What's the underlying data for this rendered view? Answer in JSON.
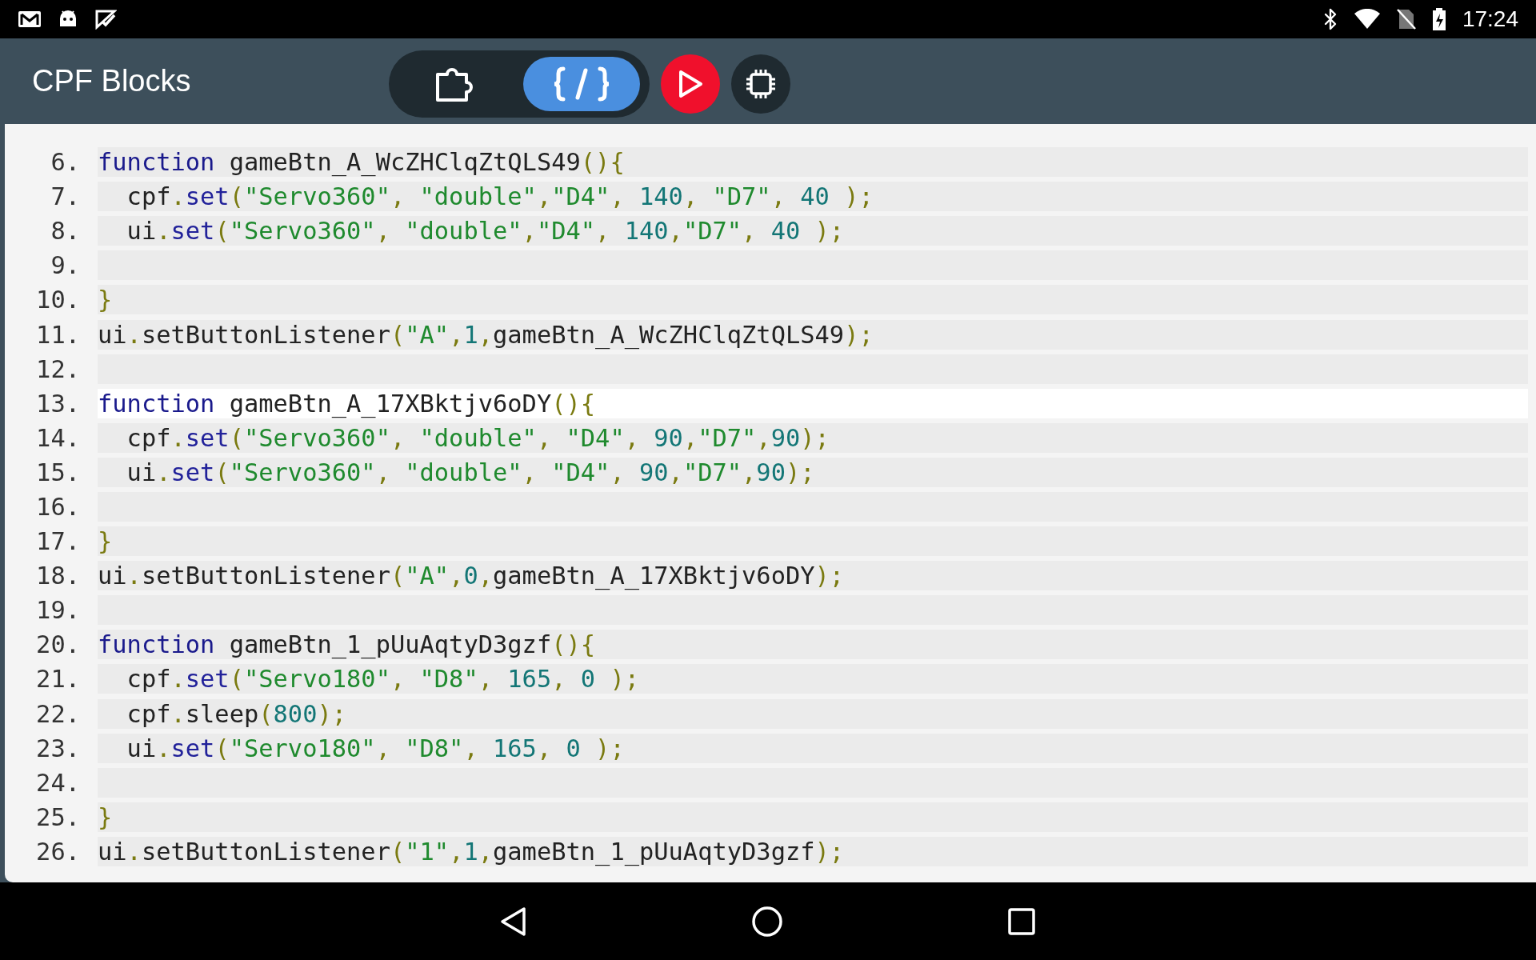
{
  "status_bar": {
    "time": "17:24"
  },
  "app_bar": {
    "title": "CPF Blocks",
    "view_tabs": [
      {
        "kind": "blocks",
        "selected": false
      },
      {
        "kind": "code",
        "selected": true
      }
    ],
    "run_button": {
      "kind": "run"
    },
    "device_button": {
      "kind": "device"
    }
  },
  "code": {
    "lines": [
      {
        "number": "6.",
        "active": false,
        "tokens": [
          {
            "kind": "kw",
            "text": "function"
          },
          {
            "kind": "plain",
            "text": " gameBtn_A_WcZHClqZtQLS49"
          },
          {
            "kind": "punct",
            "text": "(){"
          }
        ]
      },
      {
        "number": "7.",
        "active": false,
        "tokens": [
          {
            "kind": "plain",
            "text": "  cpf"
          },
          {
            "kind": "punct",
            "text": "."
          },
          {
            "kind": "prop",
            "text": "set"
          },
          {
            "kind": "punct",
            "text": "("
          },
          {
            "kind": "str",
            "text": "\"Servo360\""
          },
          {
            "kind": "punct",
            "text": ", "
          },
          {
            "kind": "str",
            "text": "\"double\""
          },
          {
            "kind": "punct",
            "text": ","
          },
          {
            "kind": "str",
            "text": "\"D4\""
          },
          {
            "kind": "punct",
            "text": ", "
          },
          {
            "kind": "num",
            "text": "140"
          },
          {
            "kind": "punct",
            "text": ", "
          },
          {
            "kind": "str",
            "text": "\"D7\""
          },
          {
            "kind": "punct",
            "text": ", "
          },
          {
            "kind": "num",
            "text": "40"
          },
          {
            "kind": "punct",
            "text": " );"
          }
        ]
      },
      {
        "number": "8.",
        "active": false,
        "tokens": [
          {
            "kind": "plain",
            "text": "  ui"
          },
          {
            "kind": "punct",
            "text": "."
          },
          {
            "kind": "prop",
            "text": "set"
          },
          {
            "kind": "punct",
            "text": "("
          },
          {
            "kind": "str",
            "text": "\"Servo360\""
          },
          {
            "kind": "punct",
            "text": ", "
          },
          {
            "kind": "str",
            "text": "\"double\""
          },
          {
            "kind": "punct",
            "text": ","
          },
          {
            "kind": "str",
            "text": "\"D4\""
          },
          {
            "kind": "punct",
            "text": ", "
          },
          {
            "kind": "num",
            "text": "140"
          },
          {
            "kind": "punct",
            "text": ","
          },
          {
            "kind": "str",
            "text": "\"D7\""
          },
          {
            "kind": "punct",
            "text": ", "
          },
          {
            "kind": "num",
            "text": "40"
          },
          {
            "kind": "punct",
            "text": " );"
          }
        ]
      },
      {
        "number": "9.",
        "active": false
      },
      {
        "number": "10.",
        "active": false,
        "tokens": [
          {
            "kind": "punct",
            "text": "}"
          }
        ]
      },
      {
        "number": "11.",
        "active": false,
        "tokens": [
          {
            "kind": "plain",
            "text": "ui"
          },
          {
            "kind": "punct",
            "text": "."
          },
          {
            "kind": "plain",
            "text": "setButtonListener"
          },
          {
            "kind": "punct",
            "text": "("
          },
          {
            "kind": "str",
            "text": "\"A\""
          },
          {
            "kind": "punct",
            "text": ","
          },
          {
            "kind": "num",
            "text": "1"
          },
          {
            "kind": "punct",
            "text": ","
          },
          {
            "kind": "plain",
            "text": "gameBtn_A_WcZHClqZtQLS49"
          },
          {
            "kind": "punct",
            "text": ");"
          }
        ]
      },
      {
        "number": "12.",
        "active": false
      },
      {
        "number": "13.",
        "active": true,
        "tokens": [
          {
            "kind": "kw",
            "text": "function"
          },
          {
            "kind": "plain",
            "text": " gameBtn_A_17XBktjv6oDY"
          },
          {
            "kind": "punct",
            "text": "(){"
          }
        ]
      },
      {
        "number": "14.",
        "active": false,
        "tokens": [
          {
            "kind": "plain",
            "text": "  cpf"
          },
          {
            "kind": "punct",
            "text": "."
          },
          {
            "kind": "prop",
            "text": "set"
          },
          {
            "kind": "punct",
            "text": "("
          },
          {
            "kind": "str",
            "text": "\"Servo360\""
          },
          {
            "kind": "punct",
            "text": ", "
          },
          {
            "kind": "str",
            "text": "\"double\""
          },
          {
            "kind": "punct",
            "text": ", "
          },
          {
            "kind": "str",
            "text": "\"D4\""
          },
          {
            "kind": "punct",
            "text": ", "
          },
          {
            "kind": "num",
            "text": "90"
          },
          {
            "kind": "punct",
            "text": ","
          },
          {
            "kind": "str",
            "text": "\"D7\""
          },
          {
            "kind": "punct",
            "text": ","
          },
          {
            "kind": "num",
            "text": "90"
          },
          {
            "kind": "punct",
            "text": ");"
          }
        ]
      },
      {
        "number": "15.",
        "active": false,
        "tokens": [
          {
            "kind": "plain",
            "text": "  ui"
          },
          {
            "kind": "punct",
            "text": "."
          },
          {
            "kind": "prop",
            "text": "set"
          },
          {
            "kind": "punct",
            "text": "("
          },
          {
            "kind": "str",
            "text": "\"Servo360\""
          },
          {
            "kind": "punct",
            "text": ", "
          },
          {
            "kind": "str",
            "text": "\"double\""
          },
          {
            "kind": "punct",
            "text": ", "
          },
          {
            "kind": "str",
            "text": "\"D4\""
          },
          {
            "kind": "punct",
            "text": ", "
          },
          {
            "kind": "num",
            "text": "90"
          },
          {
            "kind": "punct",
            "text": ","
          },
          {
            "kind": "str",
            "text": "\"D7\""
          },
          {
            "kind": "punct",
            "text": ","
          },
          {
            "kind": "num",
            "text": "90"
          },
          {
            "kind": "punct",
            "text": ");"
          }
        ]
      },
      {
        "number": "16.",
        "active": false
      },
      {
        "number": "17.",
        "active": false,
        "tokens": [
          {
            "kind": "punct",
            "text": "}"
          }
        ]
      },
      {
        "number": "18.",
        "active": false,
        "tokens": [
          {
            "kind": "plain",
            "text": "ui"
          },
          {
            "kind": "punct",
            "text": "."
          },
          {
            "kind": "plain",
            "text": "setButtonListener"
          },
          {
            "kind": "punct",
            "text": "("
          },
          {
            "kind": "str",
            "text": "\"A\""
          },
          {
            "kind": "punct",
            "text": ","
          },
          {
            "kind": "num",
            "text": "0"
          },
          {
            "kind": "punct",
            "text": ","
          },
          {
            "kind": "plain",
            "text": "gameBtn_A_17XBktjv6oDY"
          },
          {
            "kind": "punct",
            "text": ");"
          }
        ]
      },
      {
        "number": "19.",
        "active": false
      },
      {
        "number": "20.",
        "active": false,
        "tokens": [
          {
            "kind": "kw",
            "text": "function"
          },
          {
            "kind": "plain",
            "text": " gameBtn_1_pUuAqtyD3gzf"
          },
          {
            "kind": "punct",
            "text": "(){"
          }
        ]
      },
      {
        "number": "21.",
        "active": false,
        "tokens": [
          {
            "kind": "plain",
            "text": "  cpf"
          },
          {
            "kind": "punct",
            "text": "."
          },
          {
            "kind": "prop",
            "text": "set"
          },
          {
            "kind": "punct",
            "text": "("
          },
          {
            "kind": "str",
            "text": "\"Servo180\""
          },
          {
            "kind": "punct",
            "text": ", "
          },
          {
            "kind": "str",
            "text": "\"D8\""
          },
          {
            "kind": "punct",
            "text": ", "
          },
          {
            "kind": "num",
            "text": "165"
          },
          {
            "kind": "punct",
            "text": ", "
          },
          {
            "kind": "num",
            "text": "0"
          },
          {
            "kind": "punct",
            "text": " );"
          }
        ]
      },
      {
        "number": "22.",
        "active": false,
        "tokens": [
          {
            "kind": "plain",
            "text": "  cpf"
          },
          {
            "kind": "punct",
            "text": "."
          },
          {
            "kind": "plain",
            "text": "sleep"
          },
          {
            "kind": "punct",
            "text": "("
          },
          {
            "kind": "num",
            "text": "800"
          },
          {
            "kind": "punct",
            "text": ");"
          }
        ]
      },
      {
        "number": "23.",
        "active": false,
        "tokens": [
          {
            "kind": "plain",
            "text": "  ui"
          },
          {
            "kind": "punct",
            "text": "."
          },
          {
            "kind": "prop",
            "text": "set"
          },
          {
            "kind": "punct",
            "text": "("
          },
          {
            "kind": "str",
            "text": "\"Servo180\""
          },
          {
            "kind": "punct",
            "text": ", "
          },
          {
            "kind": "str",
            "text": "\"D8\""
          },
          {
            "kind": "punct",
            "text": ", "
          },
          {
            "kind": "num",
            "text": "165"
          },
          {
            "kind": "punct",
            "text": ", "
          },
          {
            "kind": "num",
            "text": "0"
          },
          {
            "kind": "punct",
            "text": " );"
          }
        ]
      },
      {
        "number": "24.",
        "active": false
      },
      {
        "number": "25.",
        "active": false,
        "tokens": [
          {
            "kind": "punct",
            "text": "}"
          }
        ]
      },
      {
        "number": "26.",
        "active": false,
        "tokens": [
          {
            "kind": "plain",
            "text": "ui"
          },
          {
            "kind": "punct",
            "text": "."
          },
          {
            "kind": "plain",
            "text": "setButtonListener"
          },
          {
            "kind": "punct",
            "text": "("
          },
          {
            "kind": "str",
            "text": "\"1\""
          },
          {
            "kind": "punct",
            "text": ","
          },
          {
            "kind": "num",
            "text": "1"
          },
          {
            "kind": "punct",
            "text": ","
          },
          {
            "kind": "plain",
            "text": "gameBtn_1_pUuAqtyD3gzf"
          },
          {
            "kind": "punct",
            "text": ");"
          }
        ]
      }
    ]
  }
}
